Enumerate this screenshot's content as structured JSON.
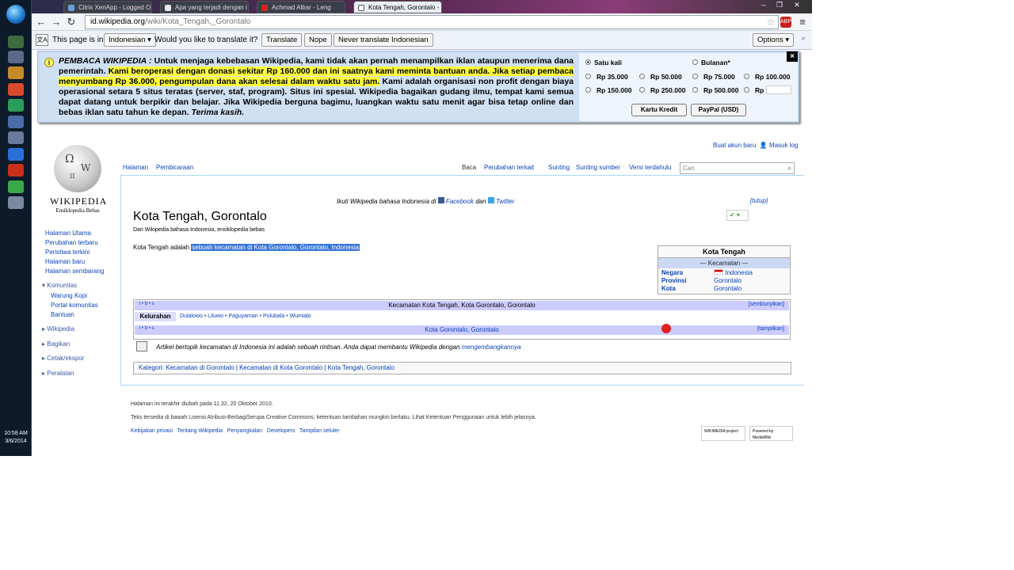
{
  "taskbar": {
    "clock_time": "10:58 AM",
    "clock_date": "3/6/2014"
  },
  "browser": {
    "tabs": [
      {
        "title": "Citrix XenApp - Logged O"
      },
      {
        "title": "Apa yang terjadi dengan i"
      },
      {
        "title": "Achmad Albar - Leng"
      },
      {
        "title": "Kota Tengah, Gorontalo -"
      }
    ],
    "url_domain": "id.wikipedia.org",
    "url_path": "/wiki/Kota_Tengah,_Gorontalo"
  },
  "translate_bar": {
    "prefix": "This page is in",
    "language": "Indonesian",
    "question": "Would you like to translate it?",
    "translate": "Translate",
    "nope": "Nope",
    "never": "Never translate Indonesian",
    "options": "Options",
    "close": "×"
  },
  "banner": {
    "lead_italic": "PEMBACA WIKIPEDIA :",
    "text1": "Untuk menjaga kebebasan Wikipedia, kami tidak akan pernah menampilkan iklan ataupun menerima dana",
    "text2": "pemerintah.",
    "highlight": "Kami beroperasi dengan donasi sekitar Rp 160.000 dan ini saatnya kami meminta bantuan anda. Jika setiap pembaca menyumbang Rp 36.000, pengumpulan dana akan selesai dalam waktu satu jam.",
    "text3": "Kami adalah organisasi non profit dengan biaya operasional setara 5 situs teratas (server, staf, program). Situs ini spesial. Wikipedia bagaikan gudang ilmu, tempat kami semua dapat datang untuk berpikir dan belajar. Jika Wikipedia berguna bagimu, luangkan waktu satu menit agar bisa tetap online dan bebas iklan satu tahun ke depan.",
    "thanks": "Terima kasih.",
    "freq_once": "Satu kali",
    "freq_monthly": "Bulanan*",
    "amounts": [
      "Rp 35.000",
      "Rp 50.000",
      "Rp 75.000",
      "Rp 100.000",
      "Rp 150.000",
      "Rp 250.000",
      "Rp 500.000",
      "Rp"
    ],
    "btn_card": "Kartu Kredit",
    "btn_paypal": "PayPal (USD)",
    "close": "×"
  },
  "wiki": {
    "wordmark": "WIKIPEDIA",
    "tagline": "Ensiklopedia Bebas",
    "personal": [
      "Buat akun baru",
      "Masuk log"
    ],
    "tabs_left": [
      "Halaman",
      "Pembicaraan"
    ],
    "tabs_right": [
      "Baca",
      "Perubahan terkait",
      "Sunting",
      "Sunting sumber",
      "Versi terdahulu"
    ],
    "search_placeholder": "Cari",
    "sidebar": [
      "Halaman Utama",
      "Perubahan terbaru",
      "Peristiwa terkini",
      "Halaman baru",
      "Halaman sembarang"
    ],
    "sidebar_comm_head": "Komunitas",
    "sidebar_comm": [
      "Warung Kopi",
      "Portal komunitas",
      "Bantuan"
    ],
    "sidebar_heads": [
      "Wikipedia",
      "Bagikan",
      "Cetak/ekspor",
      "Peralatan"
    ],
    "follow_prefix": "Ikuti Wikipedia bahasa Indonesia di",
    "follow_fb": "Facebook",
    "follow_and": "dan",
    "follow_tw": "Twitter",
    "tutup": "[tutup]",
    "title": "Kota Tengah, Gorontalo",
    "from": "Dari Wikipedia bahasa Indonesia, ensiklopedia bebas",
    "lead_plain": "Kota Tengah adalah",
    "lead_selected": "sebuah kecamatan di Kota Gorontalo, Gorontalo, Indonesia",
    "infobox": {
      "title": "Kota Tengah",
      "subtitle": "— Kecamatan —",
      "rows": [
        {
          "k": "Negara",
          "v": "Indonesia"
        },
        {
          "k": "Provinsi",
          "v": "Gorontalo"
        },
        {
          "k": "Kota",
          "v": "Gorontalo"
        }
      ]
    },
    "nav1_vte": "l • b • s",
    "nav1_title": "Kecamatan Kota Tengah, Kota Gorontalo, Gorontalo",
    "nav1_hide": "[sembunyikan]",
    "nav1_group": "Kelurahan",
    "nav1_list": "Dulalowo • Liluwo • Paguyaman • Pulubala • Wumialo",
    "nav2_vte": "l • b • s",
    "nav2_title": "Kota Gorontalo, Gorontalo",
    "nav2_show": "[tampilkan]",
    "stub_text": "Artikel bertopik kecamatan di Indonesia ini adalah sebuah rintisan. Anda dapat membantu Wikipedia dengan",
    "stub_link": "mengembangkannya",
    "cat_label": "Kategori:",
    "cats": [
      "Kecamatan di Gorontalo",
      "Kecamatan di Kota Gorontalo",
      "Kota Tengah, Gorontalo"
    ],
    "footer_modified": "Halaman ini terakhir diubah pada 11.32, 20 Oktober 2010.",
    "footer_license": "Teks tersedia di bawah Lisensi Atribusi-BerbagiSerupa Creative Commons; ketentuan tambahan mungkin berlaku. Lihat Ketentuan Penggunaan untuk lebih jelasnya.",
    "footer_links": [
      "Kebijakan privasi",
      "Tentang Wikipedia",
      "Penyangkalan",
      "Developers",
      "Tampilan seluler"
    ],
    "badge_wmf": "WIKIMEDIA project",
    "badge_mw": "Powered by MediaWiki"
  },
  "colors": {
    "link": "#0b45b8",
    "highlight": "#ffff3a",
    "selection": "#3875d7",
    "banner_bg": "#c9dcf2"
  }
}
